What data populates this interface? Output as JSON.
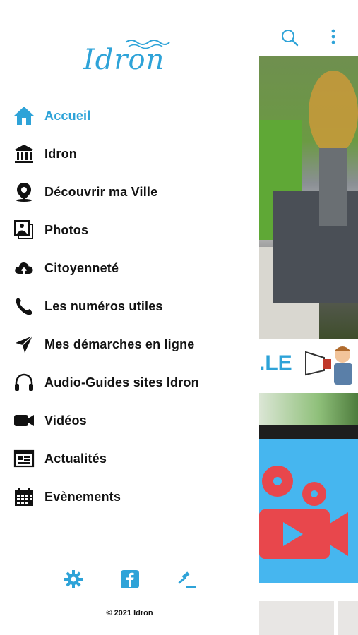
{
  "app": {
    "logo_text": "Idron",
    "accent_color": "#2ea3d8"
  },
  "menu": {
    "items": [
      {
        "label": "Accueil",
        "icon": "home-icon",
        "active": true
      },
      {
        "label": "Idron",
        "icon": "town-hall-icon"
      },
      {
        "label": "Découvrir ma Ville",
        "icon": "map-pin-icon"
      },
      {
        "label": "Photos",
        "icon": "photos-icon"
      },
      {
        "label": "Citoyenneté",
        "icon": "cloud-upload-icon"
      },
      {
        "label": "Les numéros utiles",
        "icon": "phone-icon"
      },
      {
        "label": "Mes démarches en ligne",
        "icon": "send-icon"
      },
      {
        "label": "Audio-Guides sites Idron",
        "icon": "headphones-icon"
      },
      {
        "label": "Vidéos",
        "icon": "video-camera-icon"
      },
      {
        "label": "Actualités",
        "icon": "news-icon"
      },
      {
        "label": "Evènements",
        "icon": "calendar-icon"
      }
    ]
  },
  "footer": {
    "icons": [
      "settings-icon",
      "facebook-icon",
      "legal-gavel-icon"
    ],
    "copyright": "© 2021 Idron"
  },
  "background": {
    "banner_text": ".LE"
  }
}
